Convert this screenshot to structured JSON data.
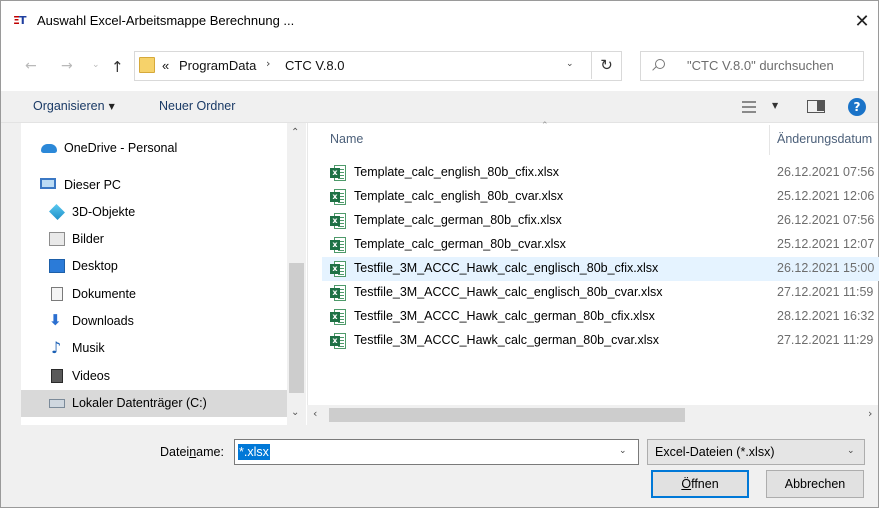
{
  "window": {
    "title": "Auswahl Excel-Arbeitsmappe Berechnung ...",
    "app_icon_text": "Ξ",
    "app_icon_text2": "T",
    "close_glyph": "✕"
  },
  "address": {
    "back_glyph": "←",
    "forward_glyph": "→",
    "recent_glyph": "⌄",
    "up_glyph": "↑",
    "overflow": "«",
    "crumbs": [
      "ProgramData",
      "CTC V.8.0"
    ],
    "separator": "›",
    "dropdown_glyph": "⌄",
    "refresh_glyph": "↻",
    "search_placeholder": "\"CTC V.8.0\" durchsuchen"
  },
  "toolbar": {
    "organize_label": "Organisieren",
    "organize_arrow": "▼",
    "new_folder_label": "Neuer Ordner",
    "view_arrow": "▼",
    "help_glyph": "?"
  },
  "navigation": {
    "items": [
      {
        "label": "OneDrive - Personal",
        "icon": "onedrive-icon"
      },
      {
        "label": "Dieser PC",
        "icon": "computer-icon"
      },
      {
        "label": "3D-Objekte",
        "icon": "3d-objects-icon"
      },
      {
        "label": "Bilder",
        "icon": "pictures-icon"
      },
      {
        "label": "Desktop",
        "icon": "desktop-icon"
      },
      {
        "label": "Dokumente",
        "icon": "documents-icon"
      },
      {
        "label": "Downloads",
        "icon": "downloads-icon"
      },
      {
        "label": "Musik",
        "icon": "music-icon"
      },
      {
        "label": "Videos",
        "icon": "videos-icon"
      },
      {
        "label": "Lokaler Datenträger (C:)",
        "icon": "drive-icon"
      }
    ],
    "selected": "Lokaler Datenträger (C:)",
    "download_glyph": "⬇",
    "music_glyph": "♪",
    "scroll_up_glyph": "⌃",
    "scroll_down_glyph": "⌄"
  },
  "file_list": {
    "columns": {
      "name": "Name",
      "date": "Änderungsdatum"
    },
    "sort_glyph": "⌃",
    "files": [
      {
        "name": "Template_calc_english_80b_cfix.xlsx",
        "date": "26.12.2021 07:56"
      },
      {
        "name": "Template_calc_english_80b_cvar.xlsx",
        "date": "25.12.2021 12:06"
      },
      {
        "name": "Template_calc_german_80b_cfix.xlsx",
        "date": "26.12.2021 07:56"
      },
      {
        "name": "Template_calc_german_80b_cvar.xlsx",
        "date": "25.12.2021 12:07"
      },
      {
        "name": "Testfile_3M_ACCC_Hawk_calc_englisch_80b_cfix.xlsx",
        "date": "26.12.2021 15:00"
      },
      {
        "name": "Testfile_3M_ACCC_Hawk_calc_englisch_80b_cvar.xlsx",
        "date": "27.12.2021 11:59"
      },
      {
        "name": "Testfile_3M_ACCC_Hawk_calc_german_80b_cfix.xlsx",
        "date": "28.12.2021 16:32"
      },
      {
        "name": "Testfile_3M_ACCC_Hawk_calc_german_80b_cvar.xlsx",
        "date": "27.12.2021 11:29"
      }
    ],
    "hovered": "Testfile_3M_ACCC_Hawk_calc_englisch_80b_cfix.xlsx",
    "excel_badge": "x",
    "scroll_left_glyph": "‹",
    "scroll_right_glyph": "›"
  },
  "footer": {
    "filename_label_pre": "Datei",
    "filename_label_u": "n",
    "filename_label_post": "ame:",
    "filename_value": "*.xlsx",
    "filename_dd": "⌄",
    "filetype_value": "Excel-Dateien (*.xlsx)",
    "filetype_dd": "⌄",
    "open_u": "Ö",
    "open_rest": "ffnen",
    "cancel_label": "Abbrechen"
  },
  "colors": {
    "accent": "#0078d7",
    "hover_row": "#e5f3ff",
    "selected_nav": "#d9d9d9",
    "excel_green": "#1e7145"
  }
}
